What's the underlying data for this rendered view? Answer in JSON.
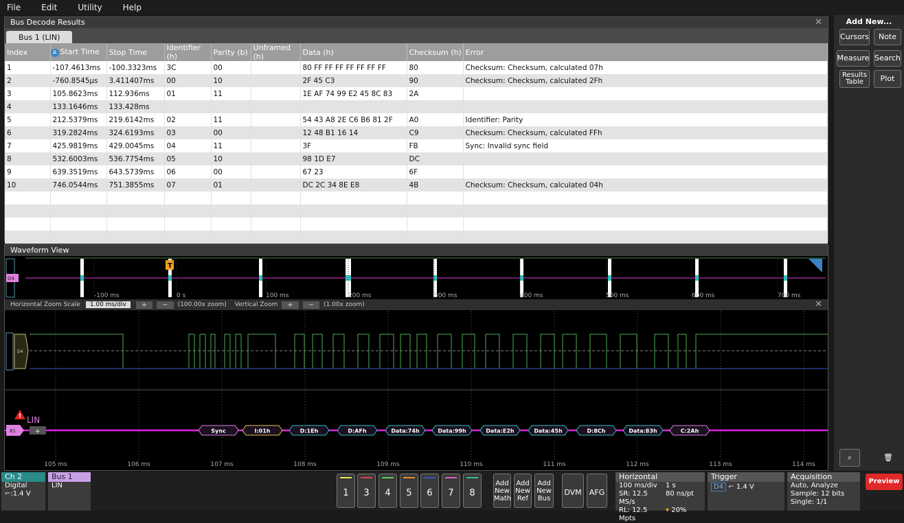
{
  "menu": [
    "File",
    "Edit",
    "Utility",
    "Help"
  ],
  "bus_decode": {
    "title": "Bus Decode Results",
    "tab": "Bus 1 (LIN)",
    "columns": [
      "Index",
      "Start Time",
      "Stop Time",
      "Identifier (h)",
      "Parity (b)",
      "Unframed (h)",
      "Data (h)",
      "Checksum (h)",
      "Error"
    ],
    "badge": "A",
    "rows": [
      [
        "1",
        "-107.4613ms",
        "-100.3323ms",
        "3C",
        "00",
        "",
        "80 FF FF FF FF FF FF FF",
        "80",
        "Checksum: Checksum, calculated 07h"
      ],
      [
        "2",
        "-760.8545µs",
        "3.411407ms",
        "00",
        "10",
        "",
        "2F 45 C3",
        "90",
        "Checksum: Checksum, calculated 2Fh"
      ],
      [
        "3",
        "105.8623ms",
        "112.936ms",
        "01",
        "11",
        "",
        "1E AF 74 99 E2 45 8C 83",
        "2A",
        ""
      ],
      [
        "4",
        "133.1646ms",
        "133.428ms",
        "",
        "",
        "",
        "",
        "",
        ""
      ],
      [
        "5",
        "212.5379ms",
        "219.6142ms",
        "02",
        "11",
        "",
        "54 43 A8 2E C6 B6 81 2F",
        "A0",
        "Identifier: Parity"
      ],
      [
        "6",
        "319.2824ms",
        "324.6193ms",
        "03",
        "00",
        "",
        "12 48 B1 16 14",
        "C9",
        "Checksum: Checksum, calculated FFh"
      ],
      [
        "7",
        "425.9819ms",
        "429.0045ms",
        "04",
        "11",
        "",
        "3F",
        "FB",
        "Sync: Invalid sync field"
      ],
      [
        "8",
        "532.6003ms",
        "536.7754ms",
        "05",
        "10",
        "",
        "98 1D E7",
        "DC",
        ""
      ],
      [
        "9",
        "639.3519ms",
        "643.5739ms",
        "06",
        "00",
        "",
        "67 23",
        "6F",
        ""
      ],
      [
        "10",
        "746.0544ms",
        "751.3855ms",
        "07",
        "01",
        "",
        "DC 2C 34 8E E8",
        "4B",
        "Checksum: Checksum, calculated 04h"
      ]
    ]
  },
  "right_panel": {
    "title": "Add New...",
    "buttons": [
      "Cursors",
      "Note",
      "Measure",
      "Search",
      "Results Table",
      "Plot"
    ]
  },
  "waveform": {
    "title": "Waveform View",
    "overview_ticks": [
      "-100 ms",
      "0 s",
      "100 ms",
      "200 ms",
      "300 ms",
      "400 ms",
      "500 ms",
      "600 ms",
      "700 ms"
    ],
    "zoom": {
      "h_label": "Horizontal Zoom Scale",
      "h_value": "1.00 ms/div",
      "h_zoom": "(100.00x zoom)",
      "v_label": "Vertical Zoom",
      "v_zoom": "(1.00x zoom)"
    },
    "digital_label": "D4",
    "lin_label": "LIN",
    "bus_badge": "B1",
    "packets": [
      "Sync",
      "I:01h",
      "D:1Eh",
      "D:AFh",
      "Data:74h",
      "Data:99h",
      "Data:E2h",
      "Data:45h",
      "D:8Ch",
      "Data:83h",
      "C:2Ah"
    ],
    "time_ticks": [
      "105 ms",
      "106 ms",
      "107 ms",
      "108 ms",
      "109 ms",
      "110 ms",
      "111 ms",
      "112 ms",
      "113 ms",
      "114 ms"
    ]
  },
  "bottom": {
    "ch2": {
      "title": "Ch 2",
      "l1": "Digital",
      "l2": "1.4 V"
    },
    "bus1": {
      "title": "Bus 1",
      "l1": "LIN"
    },
    "channels": [
      "1",
      "3",
      "4",
      "5",
      "6",
      "7",
      "8"
    ],
    "channel_colors": [
      "#e8e85a",
      "#e04050",
      "#5ad05a",
      "#e89030",
      "#4050c0",
      "#e060c0",
      "#30c0a0"
    ],
    "add_math": "Add New Math",
    "add_ref": "Add New Ref",
    "add_bus": "Add New Bus",
    "dvm": "DVM",
    "afg": "AFG",
    "horizontal": {
      "title": "Horizontal",
      "a1": "100 ms/div",
      "a2": "1 s",
      "b1": "SR: 12.5 MS/s",
      "b2": "80 ns/pt",
      "c1": "RL: 12.5 Mpts",
      "c2": "20%"
    },
    "trigger": {
      "title": "Trigger",
      "src": "D4",
      "level": "1.4 V"
    },
    "acquisition": {
      "title": "Acquisition",
      "l1": "Auto,   Analyze",
      "l2": "Sample: 12 bits",
      "l3": "Single: 1/1"
    },
    "preview": "Preview"
  }
}
